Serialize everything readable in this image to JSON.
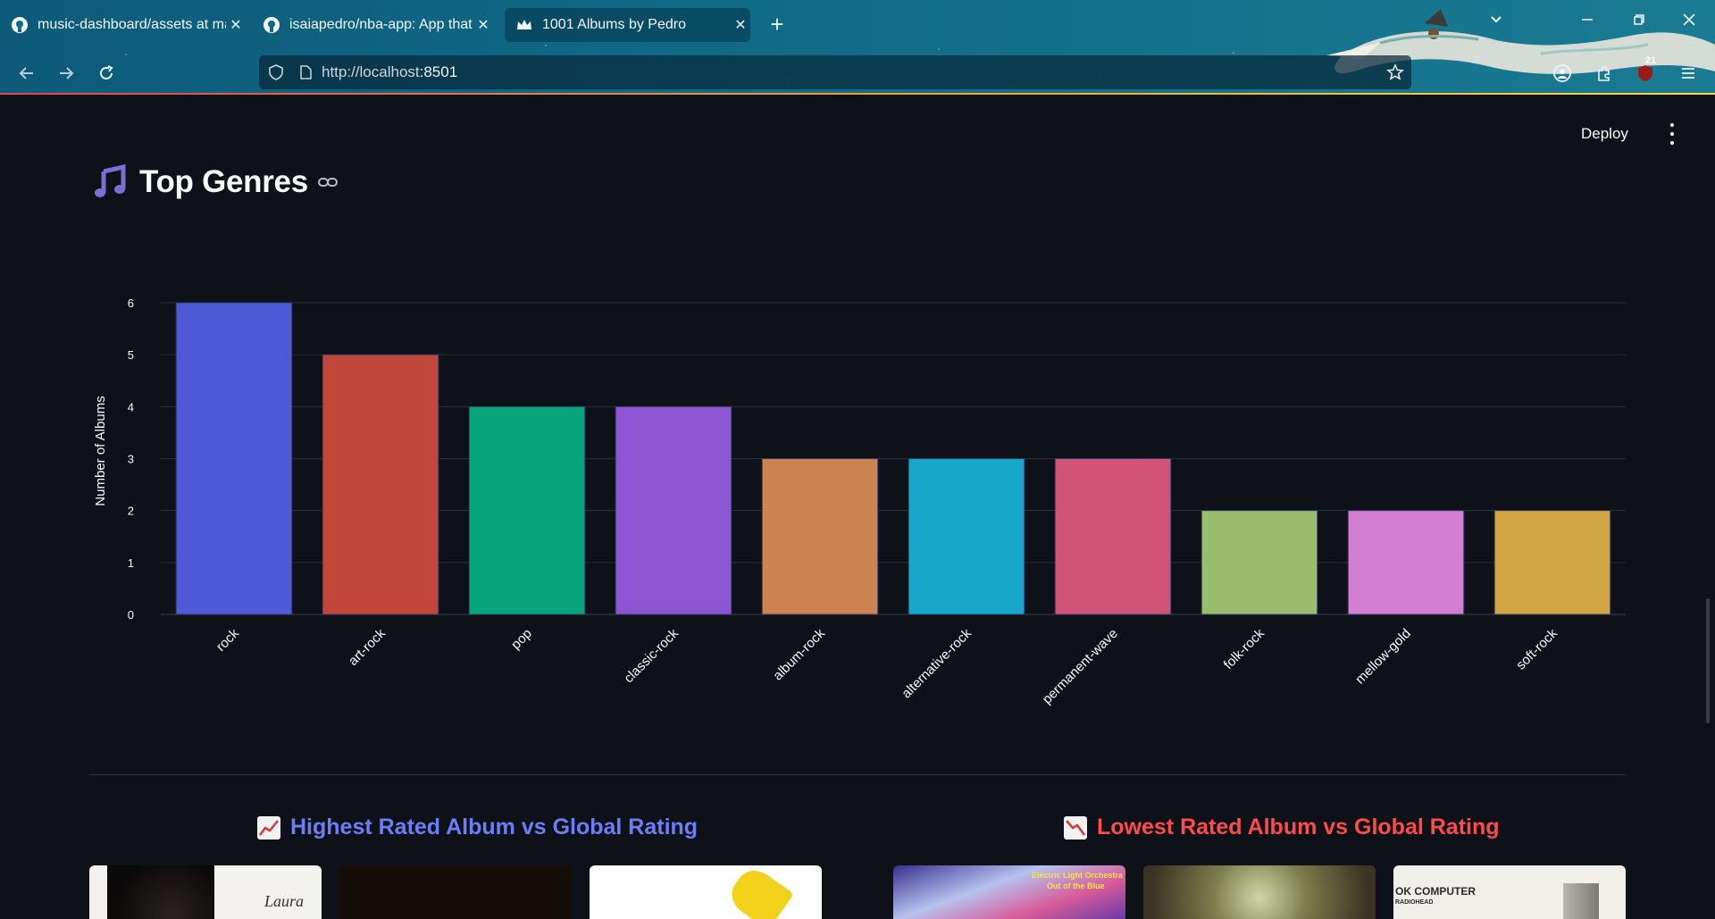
{
  "browser": {
    "tabs": [
      {
        "label": "music-dashboard/assets at main",
        "icon": "github-icon"
      },
      {
        "label": "isaiapedro/nba-app: App that sh",
        "icon": "github-icon"
      },
      {
        "label": "1001 Albums by Pedro",
        "icon": "streamlit-crown-icon",
        "active": true
      }
    ],
    "url_prefix": "http://localhost",
    "url_port": ":8501",
    "extension_badge": "21"
  },
  "app": {
    "deploy_label": "Deploy",
    "section_title": "Top Genres",
    "section_icon": "musical-notes-icon",
    "subheaders": {
      "highest": "Highest Rated Album vs Global Rating",
      "lowest": "Lowest Rated Album vs Global Rating"
    },
    "colors": {
      "highest": "#6c7ef7",
      "lowest": "#ff4b4b"
    },
    "album_covers": {
      "highest_1_text": "Laura",
      "lowest_1_text_line1": "Electric Light Orchestra",
      "lowest_1_text_line2": "Out of the Blue",
      "lowest_3_text_line1": "OK COMPUTER",
      "lowest_3_text_line2": "RADIOHEAD"
    }
  },
  "chart_data": {
    "type": "bar",
    "categories": [
      "rock",
      "art-rock",
      "pop",
      "classic-rock",
      "album-rock",
      "alternative-rock",
      "permanent-wave",
      "folk-rock",
      "mellow-gold",
      "soft-rock"
    ],
    "values": [
      6,
      5,
      4,
      4,
      3,
      3,
      3,
      2,
      2,
      2
    ],
    "colors": [
      "#5059d6",
      "#c1473a",
      "#06a57a",
      "#8c55d2",
      "#cd8450",
      "#17a8c9",
      "#d15478",
      "#99bc6d",
      "#d27ed3",
      "#d2a545"
    ],
    "ylabel": "Number of Albums",
    "xlabel": "",
    "ylim": [
      0,
      6
    ],
    "yticks": [
      0,
      1,
      2,
      3,
      4,
      5,
      6
    ],
    "grid": true
  }
}
